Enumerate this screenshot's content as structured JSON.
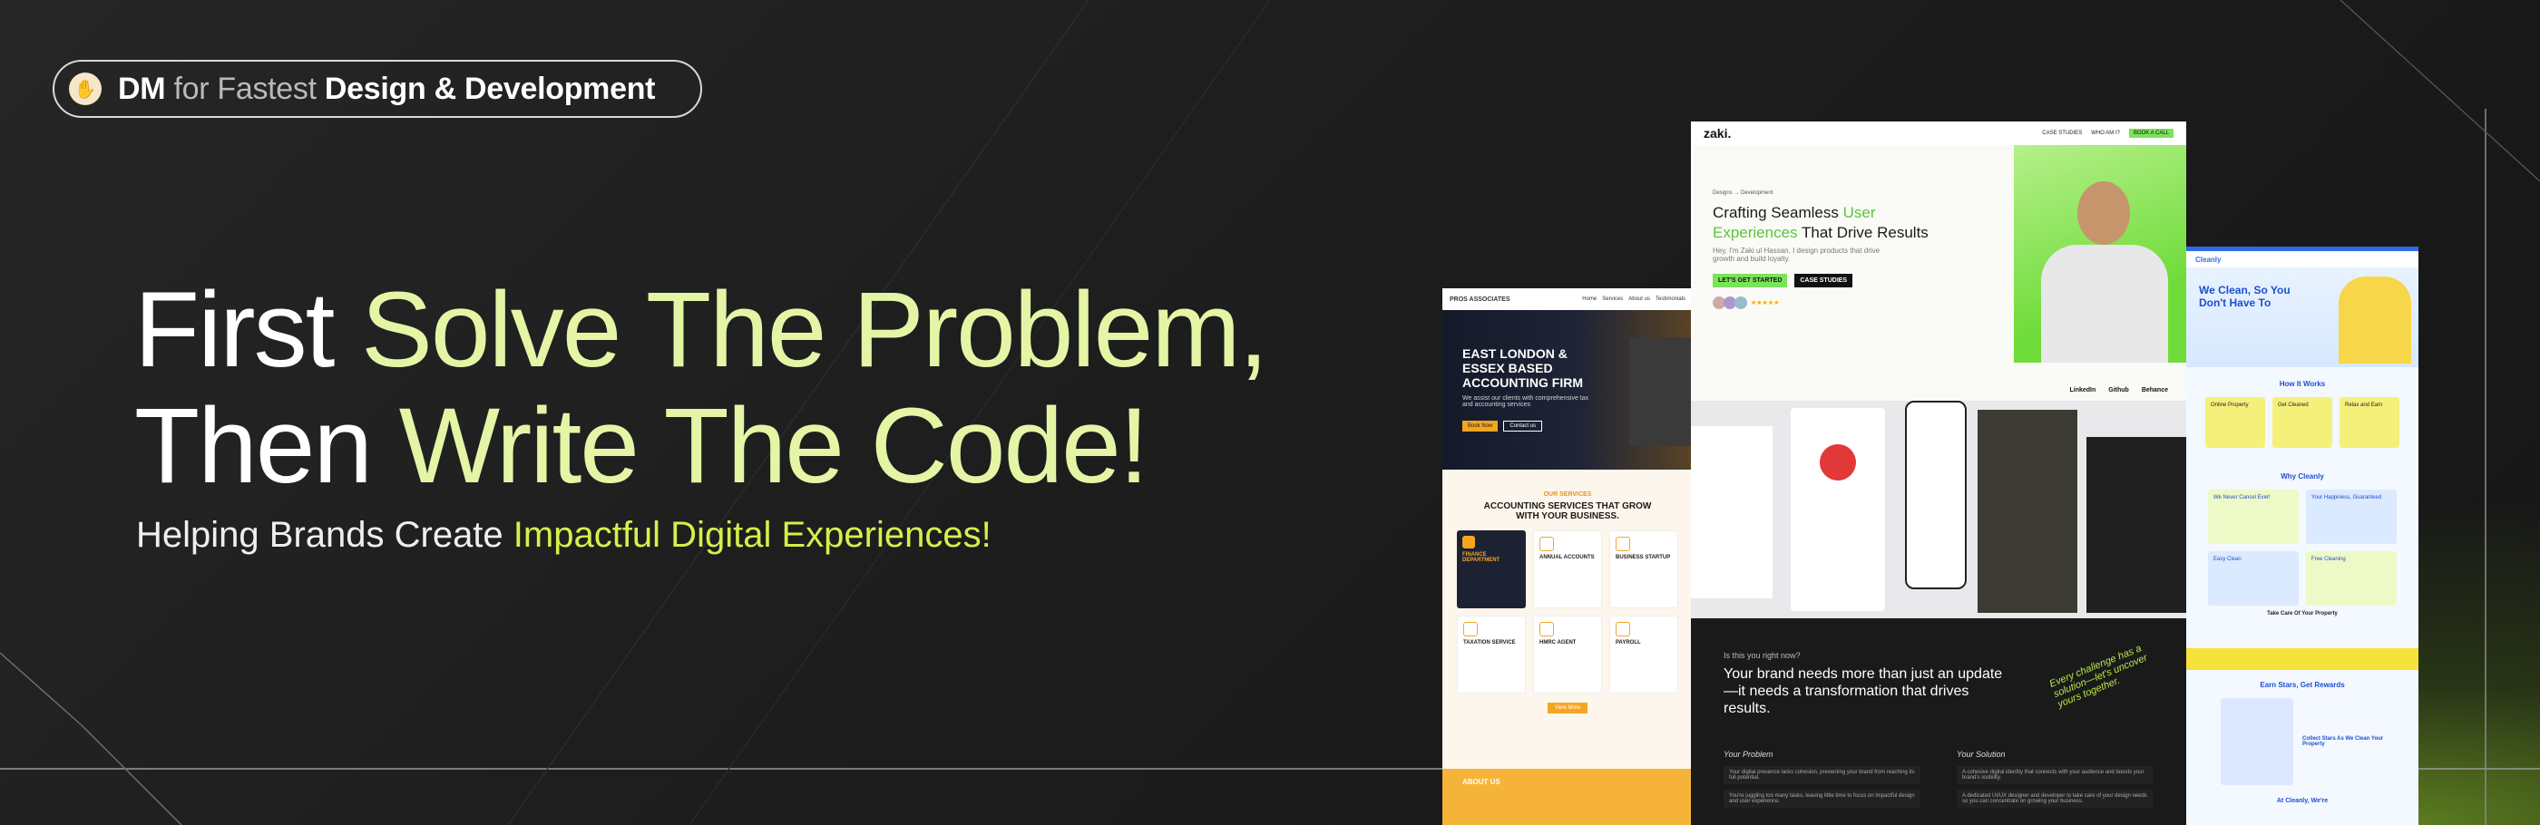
{
  "banner": {
    "pill": {
      "icon": "waving-hand-icon",
      "part1": "DM",
      "part2": "for Fastest",
      "part3": "Design & Development"
    },
    "headline": {
      "line1_white": "First ",
      "line1_lime": "Solve The Problem,",
      "line2_white": "Then ",
      "line2_lime": "Write The Code!"
    },
    "subheading": {
      "plain": "Helping Brands Create ",
      "highlight": "Impactful Digital Experiences!"
    },
    "colors": {
      "background": "#1c1c1c",
      "lime": "#e4f5a6",
      "highlight": "#d5f04a"
    }
  },
  "mockup_accounting": {
    "logo": "PROS ASSOCIATES",
    "nav": [
      "Home",
      "Services",
      "About us",
      "Testimonials"
    ],
    "hero_title": "EAST LONDON & ESSEX BASED ACCOUNTING FIRM",
    "hero_sub": "We assist our clients with comprehensive tax and accounting services",
    "btn_primary": "Book Now",
    "btn_secondary": "Contact us",
    "services_kicker": "OUR SERVICES",
    "services_title": "ACCOUNTING SERVICES THAT GROW WITH YOUR BUSINESS.",
    "cards": [
      "FINANCE DEPARTMENT",
      "ANNUAL ACCOUNTS",
      "BUSINESS STARTUP",
      "TAXATION SERVICE",
      "HMRC AGENT",
      "PAYROLL"
    ],
    "more_btn": "View More",
    "about": "ABOUT US"
  },
  "mockup_portfolio": {
    "logo": "zaki.",
    "nav": [
      "CASE STUDIES",
      "WHO AM I?"
    ],
    "cta": "BOOK A CALL",
    "breadcrumb": "Designs → Development",
    "hero_a": "Crafting Seamless ",
    "hero_b": "User",
    "hero_c": "Experiences",
    "hero_d": " That Drive Results",
    "intro": "Hey, I'm Zaki ul Hassan, I design products that drive growth and build loyalty.",
    "btn_start": "LET'S GET STARTED",
    "btn_case": "CASE STUDIES",
    "socials": [
      "LinkedIn",
      "Github",
      "Behance"
    ],
    "problem_kicker": "Is this you right now?",
    "problem_title": "Your brand needs more than just an update—it needs a transformation that drives results.",
    "script_note": "Every challenge has a solution—let's uncover yours together.",
    "col_problem": "Your Problem",
    "col_solution": "Your Solution",
    "problems": [
      "Your digital presence lacks cohesion, preventing your brand from reaching its full potential.",
      "You're juggling too many tasks, leaving little time to focus on impactful design and user experience."
    ],
    "solutions": [
      "A cohesive digital identity that connects with your audience and boosts your brand's visibility.",
      "A dedicated UI/UX designer and developer to take care of your design needs so you can concentrate on growing your business."
    ]
  },
  "mockup_cleaning": {
    "logo": "Cleanly",
    "hero": "We Clean, So You Don't Have To",
    "how": "How It Works",
    "steps": [
      "Online Property",
      "Get Cleaned",
      "Relax and Earn"
    ],
    "why": "Why Cleanly",
    "why_items": [
      "We Never Cancel Ever!",
      "Your Happiness, Guaranteed",
      "Easy Clean",
      "Free Cleaning"
    ],
    "property": "Take Care Of Your Property",
    "rewards": "Earn Stars, Get Rewards",
    "collect": "Collect Stars As We Clean Your Property",
    "footer_hint": "At Cleanly, We're"
  }
}
